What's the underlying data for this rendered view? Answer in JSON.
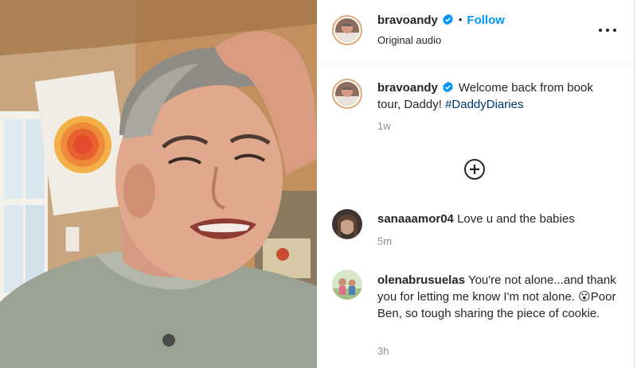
{
  "post": {
    "username": "bravoandy",
    "follow_label": "Follow",
    "audio_label": "Original audio",
    "separator": "•"
  },
  "caption": {
    "username": "bravoandy",
    "text": "Welcome back from book tour, Daddy! ",
    "hashtag": "#DaddyDiaries",
    "time": "1w"
  },
  "comments": [
    {
      "username": "sanaaamor04",
      "text": "Love u and the babies",
      "time": "5m"
    },
    {
      "username": "olenabrusuelas",
      "text": "You're not alone...and thank you for letting me know I'm not alone. 😮Poor Ben, so tough sharing the piece of cookie.",
      "time": "3h"
    }
  ],
  "icons": {
    "verified": "verified-badge-icon",
    "more": "more-options-icon",
    "load_more": "plus-circle-icon"
  },
  "colors": {
    "accent": "#0095f6",
    "verified": "#0095f6",
    "hashtag": "#00376b",
    "muted": "#8e8e8e"
  }
}
